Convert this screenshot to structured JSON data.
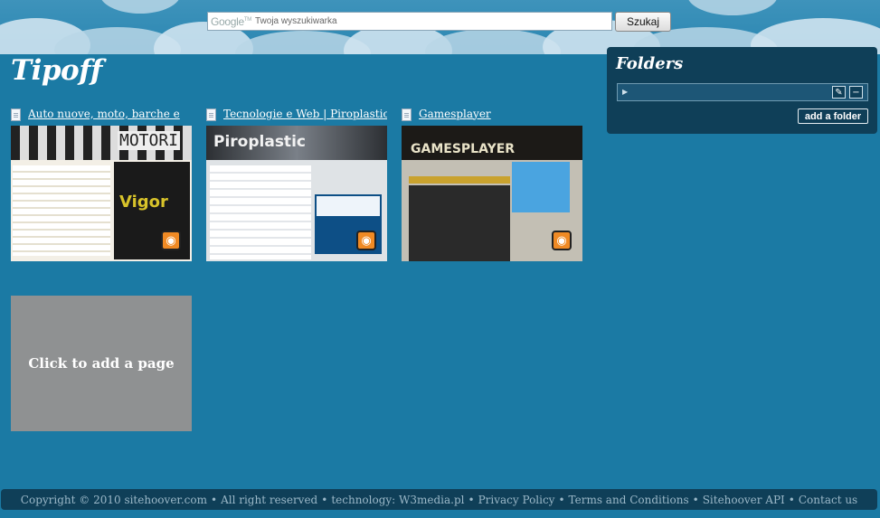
{
  "search": {
    "logo_text": "Google",
    "logo_tm": "TM",
    "placeholder": "Twoja wyszukiwarka",
    "button_label": "Szukaj"
  },
  "page": {
    "title": "Tipoff"
  },
  "cards": [
    {
      "title": "Auto nuove, moto, barche e",
      "thumb_logo": "MOTORI",
      "thumb_ad": "Vigor"
    },
    {
      "title": "Tecnologie e Web | Piroplastic",
      "thumb_logo": "Piroplastic"
    },
    {
      "title": "Gamesplayer",
      "thumb_logo": "GAMESPLAYER"
    }
  ],
  "add_page": {
    "label": "Click to add a page"
  },
  "folders": {
    "title": "Folders",
    "add_folder_label": "add a folder",
    "edit_icon": "wrench-icon",
    "remove_icon": "minus-icon"
  },
  "footer": {
    "copyright": "Copyright © 2010 sitehoover.com",
    "rights": "All right reserved",
    "technology": "technology: W3media.pl",
    "links": [
      "Privacy Policy",
      "Terms and Conditions",
      "Sitehoover API",
      "Contact us"
    ]
  },
  "colors": {
    "background": "#1b7aa4",
    "panel": "#0f3f58",
    "add_page_tile": "#8f9192",
    "rss": "#f08a24"
  }
}
